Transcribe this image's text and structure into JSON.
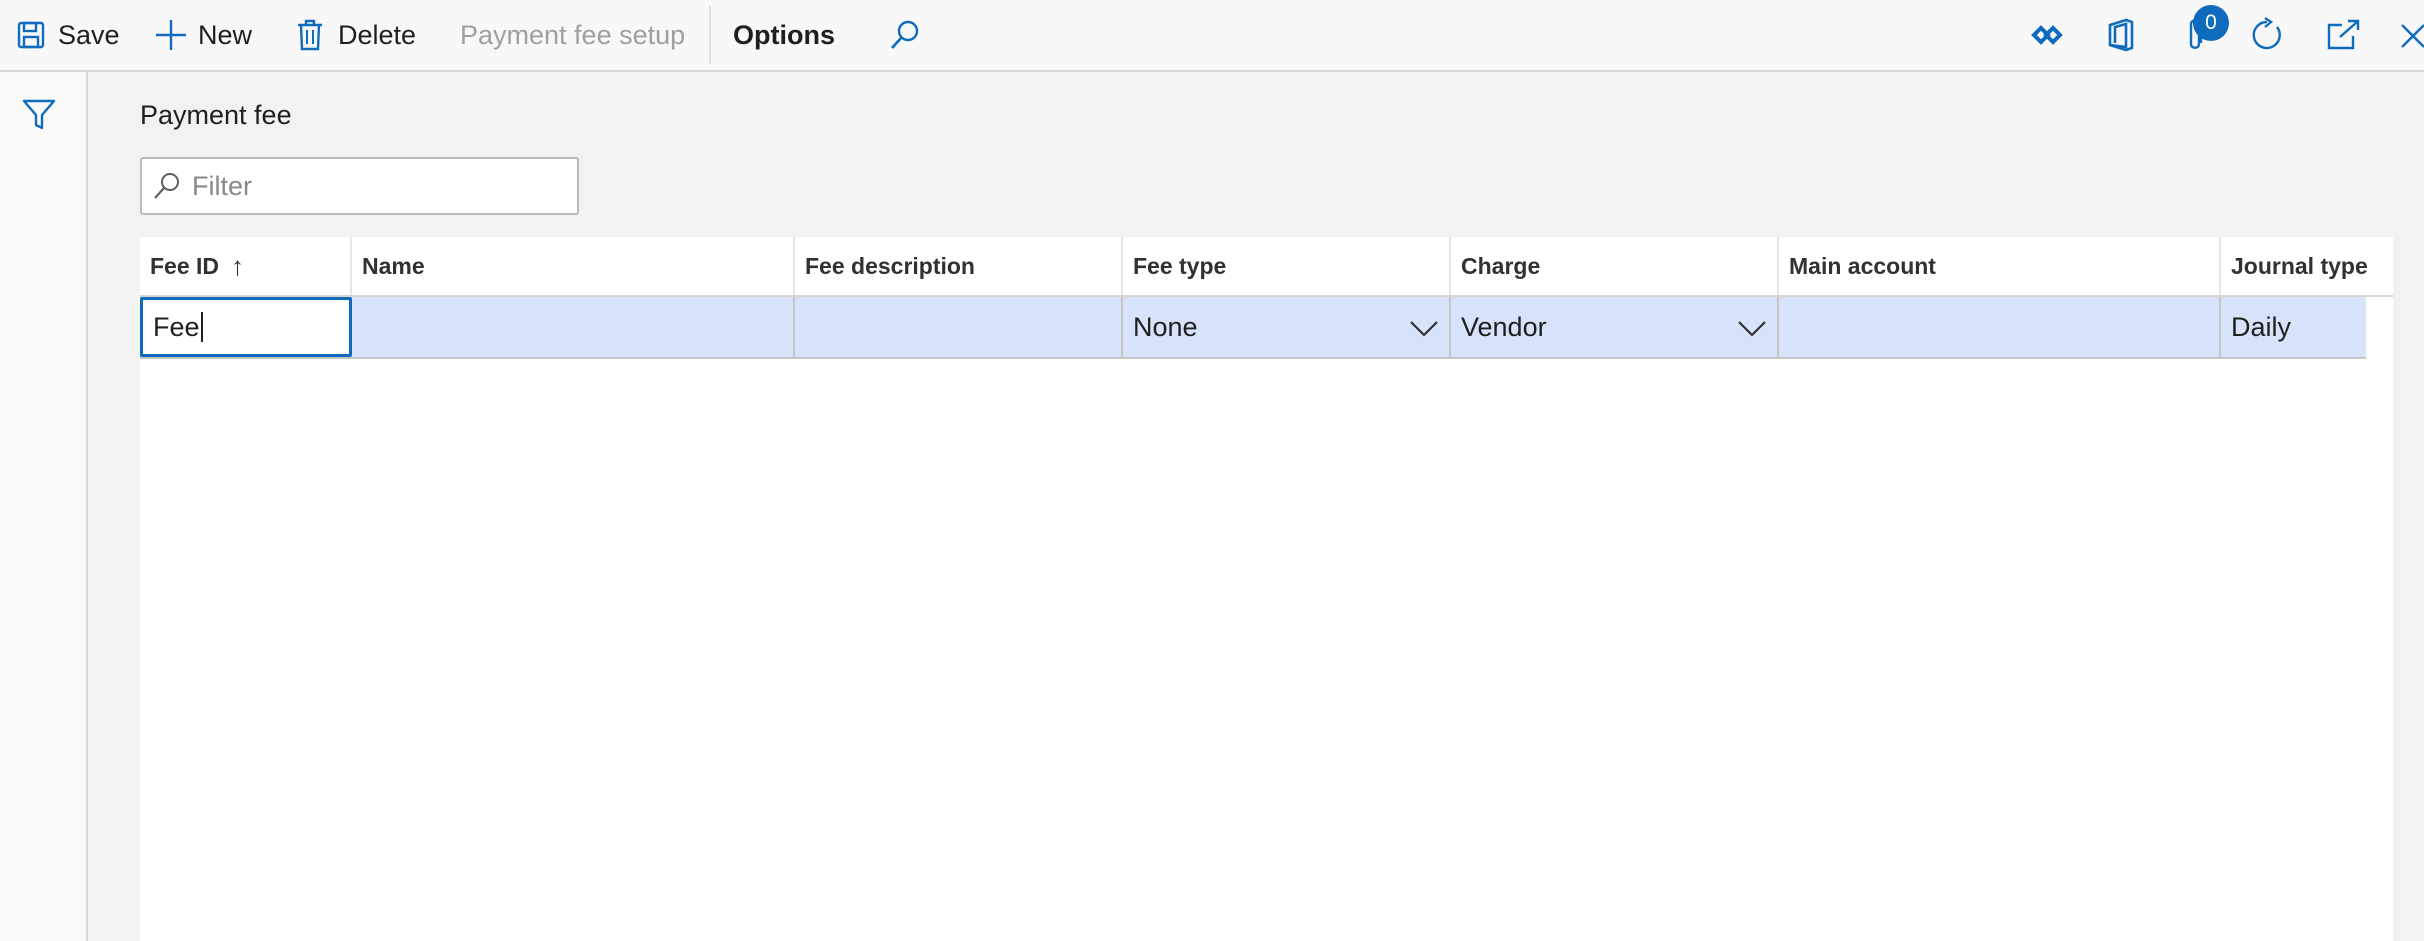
{
  "toolbar": {
    "save_label": "Save",
    "new_label": "New",
    "delete_label": "Delete",
    "payment_fee_setup_label": "Payment fee setup",
    "options_label": "Options",
    "attachments_count": "0"
  },
  "page": {
    "title": "Payment fee",
    "filter_placeholder": "Filter"
  },
  "grid": {
    "columns": [
      "Fee ID",
      "Name",
      "Fee description",
      "Fee type",
      "Charge",
      "Main account",
      "Journal type"
    ],
    "sort_indicator": "↑",
    "row": {
      "fee_id": "Fee",
      "name": "",
      "fee_description": "",
      "fee_type": "None",
      "charge": "Vendor",
      "main_account": "",
      "journal_type": "Daily"
    }
  },
  "colors": {
    "accent": "#0f6cbd",
    "selected_row": "#d6e3fa"
  },
  "icons": [
    "save-icon",
    "plus-icon",
    "trash-icon",
    "search-icon",
    "diamond-link-icon",
    "office-icon",
    "attachment-icon",
    "refresh-icon",
    "open-new-window-icon",
    "close-icon",
    "filter-icon",
    "chevron-down-icon"
  ]
}
